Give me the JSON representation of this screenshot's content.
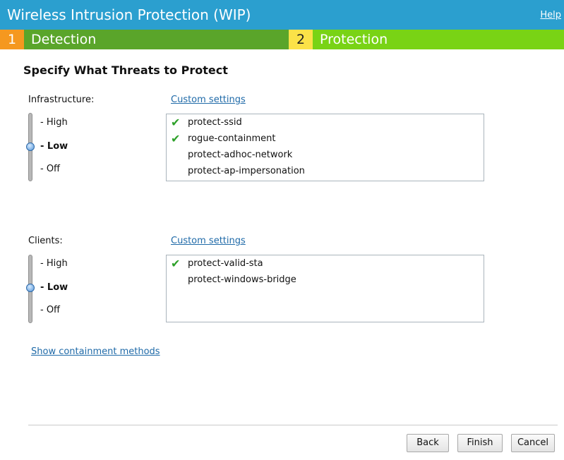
{
  "header": {
    "title": "Wireless Intrusion Protection (WIP)",
    "help": "Help"
  },
  "steps": [
    {
      "number": "1",
      "label": "Detection"
    },
    {
      "number": "2",
      "label": "Protection"
    }
  ],
  "heading": "Specify What Threats to Protect",
  "levels": [
    "- High",
    "- Low",
    "- Off"
  ],
  "infrastructure": {
    "label": "Infrastructure:",
    "custom_link": "Custom settings",
    "selected_level": "Low",
    "items": [
      {
        "name": "protect-ssid",
        "checked": true
      },
      {
        "name": "rogue-containment",
        "checked": true
      },
      {
        "name": "protect-adhoc-network",
        "checked": false
      },
      {
        "name": "protect-ap-impersonation",
        "checked": false
      }
    ]
  },
  "clients": {
    "label": "Clients:",
    "custom_link": "Custom settings",
    "selected_level": "Low",
    "items": [
      {
        "name": "protect-valid-sta",
        "checked": true
      },
      {
        "name": "protect-windows-bridge",
        "checked": false
      }
    ]
  },
  "containment_link": "Show containment methods",
  "buttons": {
    "back": "Back",
    "finish": "Finish",
    "cancel": "Cancel"
  },
  "colors": {
    "titlebar": "#2b9fcf",
    "step1_num": "#f5981f",
    "step1_bar": "#5aa52a",
    "step2_num": "#fbe248",
    "step2_bar": "#79d315",
    "check": "#2ea12a",
    "link": "#1f6aa8"
  }
}
